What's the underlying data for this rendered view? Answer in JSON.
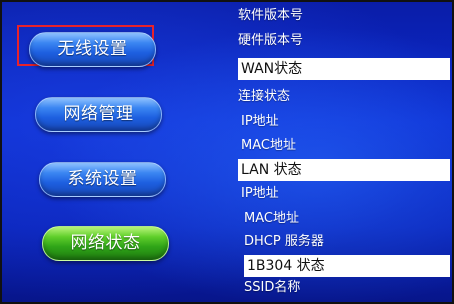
{
  "menu": {
    "items": [
      {
        "label": "无线设置",
        "style": "blue",
        "selected": true
      },
      {
        "label": "网络管理",
        "style": "blue",
        "selected": false
      },
      {
        "label": "系统设置",
        "style": "blue",
        "selected": false
      },
      {
        "label": "网络状态",
        "style": "green",
        "selected": false
      }
    ]
  },
  "info": {
    "software_version": "软件版本号",
    "hardware_version": "硬件版本号",
    "wan_status": "WAN状态",
    "connection_status": "连接状态",
    "wan_ip": "IP地址",
    "wan_mac": "MAC地址",
    "lan_status": "LAN 状态",
    "lan_ip": "IP地址",
    "lan_mac": "MAC地址",
    "dhcp_server": "DHCP 服务器",
    "wifi_status": "1B304 状态",
    "ssid_name": "SSID名称"
  },
  "colors": {
    "highlight": "#e8222b",
    "background": "#0c2bd0",
    "button_blue": "#1d5fe0",
    "button_green": "#2fa418"
  }
}
